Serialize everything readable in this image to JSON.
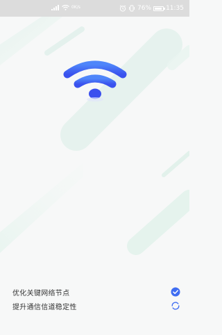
{
  "status_bar": {
    "network_speed": "0K/s",
    "battery_percent": "76%",
    "time": "11:35",
    "icons": [
      "signal-icon",
      "wifi-icon",
      "alarm-icon",
      "vibrate-icon",
      "battery-icon"
    ]
  },
  "logo": {
    "icon": "wifi-signal-icon",
    "colors": {
      "top": "#4a7ef8",
      "bottom": "#3d5cf0",
      "accent_bg": "#e3f1ec"
    }
  },
  "checklist": {
    "items": [
      {
        "label": "优化关键网络节点",
        "status": "done",
        "status_icon": "check-circle-icon"
      },
      {
        "label": "提升通信信道稳定性",
        "status": "in_progress",
        "status_icon": "loading-spinner-icon"
      }
    ]
  },
  "colors": {
    "accent": "#3f6df2",
    "background": "#f7f8f8",
    "status_bar_bg": "#dcdcdc"
  }
}
